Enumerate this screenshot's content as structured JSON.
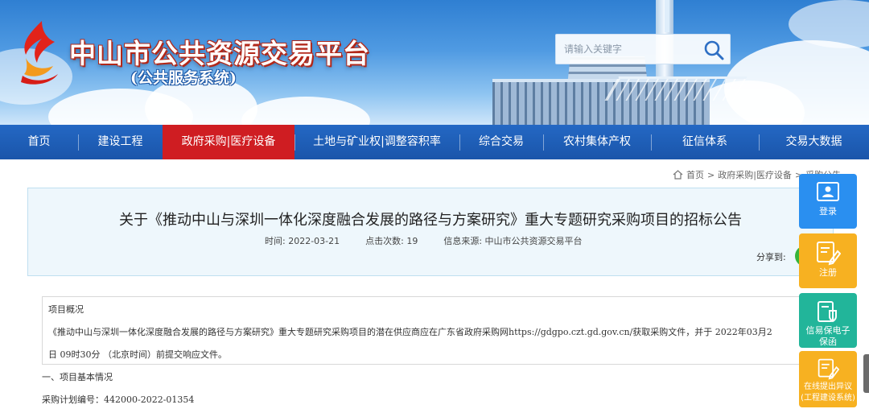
{
  "header": {
    "site_title": "中山市公共资源交易平台",
    "site_subtitle": "(公共服务系统)",
    "search_placeholder": "请输入关键字"
  },
  "nav": {
    "items": [
      {
        "label": "首页",
        "active": false
      },
      {
        "label": "建设工程",
        "active": false
      },
      {
        "label": "政府采购|医疗设备",
        "active": true
      },
      {
        "label": "土地与矿业权|调整容积率",
        "active": false
      },
      {
        "label": "综合交易",
        "active": false
      },
      {
        "label": "农村集体产权",
        "active": false
      },
      {
        "label": "征信体系",
        "active": false
      },
      {
        "label": "交易大数据",
        "active": false
      }
    ]
  },
  "breadcrumb": {
    "home": "首页",
    "sep1": ">",
    "section": "政府采购|医疗设备",
    "sep2": ">",
    "current": "采购公告"
  },
  "article": {
    "title": "关于《推动中山与深圳一体化深度融合发展的路径与方案研究》重大专题研究采购项目的招标公告",
    "meta_time": "时间:  2022-03-21",
    "meta_clicks": "点击次数:  19",
    "meta_source": "信息来源:  中山市公共资源交易平台",
    "share_label": "分享到:"
  },
  "content": {
    "overview_heading": "项目概况",
    "overview_line1": "《推动中山与深圳一体化深度融合发展的路径与方案研究》重大专题研究采购项目的潜在供应商应在广东省政府采购网https://gdgpo.czt.gd.gov.cn/获取采购文件，并于 2022年03月2",
    "overview_line2": "日 09时30分 （北京时间）前提交响应文件。",
    "section1": "一、项目基本情况",
    "plan_no": "采购计划编号：442000-2022-01354"
  },
  "float_bar": {
    "login": "登录",
    "register": "注册",
    "guarantee_line1": "信易保电子",
    "guarantee_line2": "保函",
    "objection_line1": "在线提出异议",
    "objection_line2": "(工程建设系统)"
  },
  "colors": {
    "nav_bg": "#1f5fb7",
    "nav_active": "#cf1d22",
    "panel_bg": "#eef7fc",
    "login_btn": "#2a8ff0",
    "register_btn": "#f7b121",
    "guarantee_btn": "#22b59a",
    "share_green": "#37b43a"
  }
}
